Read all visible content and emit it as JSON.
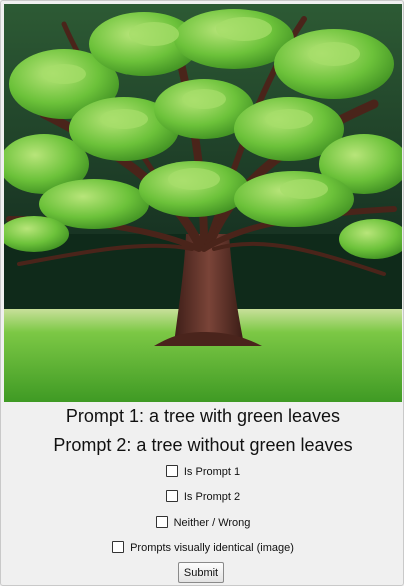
{
  "image": {
    "icon": "tree-photo",
    "alt": "",
    "colors": {
      "sky": "#1d3a26",
      "leaves": "#6cc23a",
      "leaves_light": "#a4dc67",
      "trunk": "#5a2e24",
      "grass": "#55b830"
    }
  },
  "prompts": {
    "prompt1": "Prompt 1: a tree with green leaves",
    "prompt2": "Prompt 2: a tree without green leaves"
  },
  "options": {
    "is_prompt1": "Is Prompt 1",
    "is_prompt2": "Is Prompt 2",
    "neither": "Neither / Wrong",
    "identical": "Prompts visually identical (image)"
  },
  "actions": {
    "submit_label": "Submit"
  }
}
